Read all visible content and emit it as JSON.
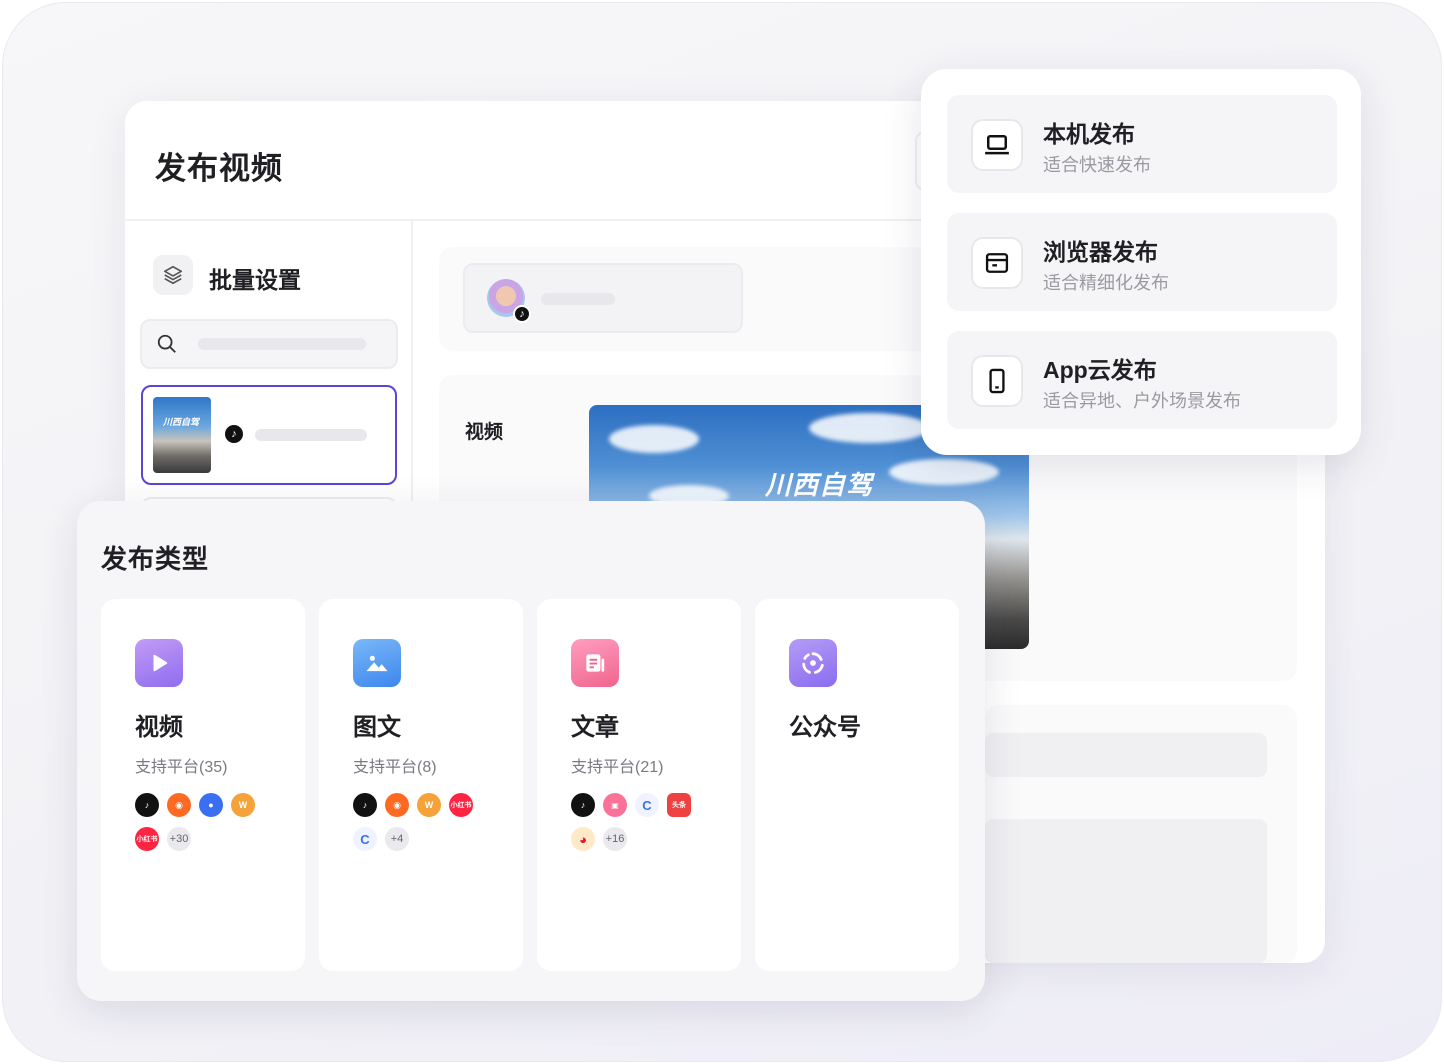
{
  "window": {
    "title": "发布视频",
    "batch_settings_label": "批量设置",
    "video_label": "视频",
    "cover_text": "川西自驾"
  },
  "publish_menu": {
    "items": [
      {
        "title": "本机发布",
        "subtitle": "适合快速发布",
        "icon": "laptop-icon"
      },
      {
        "title": "浏览器发布",
        "subtitle": "适合精细化发布",
        "icon": "browser-window-icon"
      },
      {
        "title": "App云发布",
        "subtitle": "适合异地、户外场景发布",
        "icon": "phone-icon"
      }
    ]
  },
  "publish_types": {
    "heading": "发布类型",
    "cards": [
      {
        "name": "视频",
        "subtitle": "支持平台(35)",
        "icon": "video-play-icon",
        "color": "#a982f0",
        "platforms": [
          "douyin",
          "kuaishou",
          "baidu",
          "xigua",
          "xiaohongshu"
        ],
        "more": "+30"
      },
      {
        "name": "图文",
        "subtitle": "支持平台(8)",
        "icon": "image-icon",
        "color": "#5aa0f2",
        "platforms": [
          "douyin",
          "kuaishou",
          "xigua",
          "xiaohongshu",
          "bjh"
        ],
        "more": "+4"
      },
      {
        "name": "文章",
        "subtitle": "支持平台(21)",
        "icon": "article-icon",
        "color": "#f27aa0",
        "platforms": [
          "douyin",
          "bilibili",
          "bjh",
          "toutiao",
          "weibo"
        ],
        "more": "+16"
      },
      {
        "name": "公众号",
        "subtitle": "",
        "icon": "wechat-official-icon",
        "color": "#9b7ff0",
        "platforms": [],
        "more": ""
      }
    ]
  },
  "platform_badges": {
    "xiaohongshu": "小红书",
    "toutiao": "头条"
  }
}
